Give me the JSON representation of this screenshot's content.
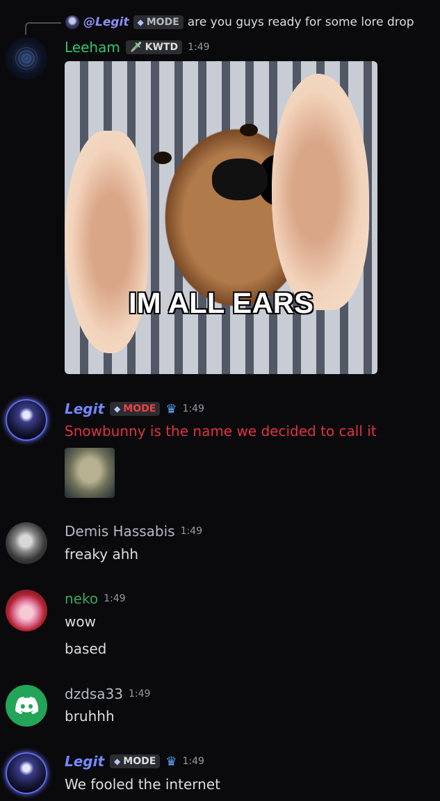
{
  "reply": {
    "author": "@Legit",
    "tag": "MODE",
    "text": "are you guys ready for some lore drop"
  },
  "messages": [
    {
      "author": "Leeham",
      "author_color": "#2dc770",
      "tag": "KWTD",
      "tag_icon": "sword-icon",
      "time": "1:49",
      "gif_caption": "IM ALL EARS"
    },
    {
      "author": "Legit",
      "author_color": "#7289ff",
      "tag": "MODE",
      "tag_color": "#f23f43",
      "time": "1:49",
      "text": "Snowbunny is the name we decided to call it",
      "text_color": "#e0343e"
    },
    {
      "author": "Demis Hassabis",
      "author_color": "#b5bac1",
      "time": "1:49",
      "text": "freaky ahh"
    },
    {
      "author": "neko",
      "author_color": "#3ba55d",
      "time": "1:49",
      "lines": [
        "wow",
        "based"
      ]
    },
    {
      "author": "dzdsa33",
      "author_color": "#b5bac1",
      "time": "1:49",
      "text": "bruhhh"
    },
    {
      "author": "Legit",
      "author_color": "#7289ff",
      "tag": "MODE",
      "time": "1:49",
      "text": "We fooled the internet"
    }
  ]
}
